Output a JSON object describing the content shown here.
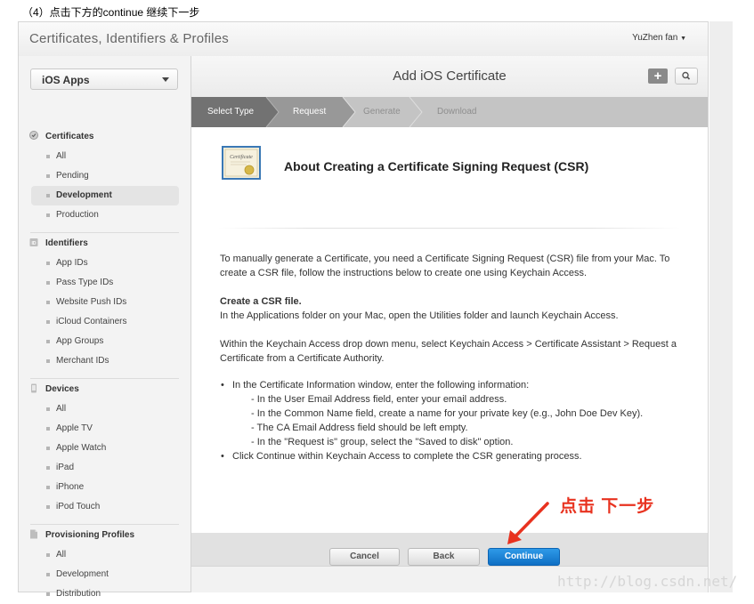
{
  "caption": "（4）点击下方的continue 继续下一步",
  "header": {
    "app_title": "Certificates, Identifiers & Profiles",
    "user": "YuZhen fan"
  },
  "sidebar": {
    "dropdown_value": "iOS Apps",
    "sections": [
      {
        "label": "Certificates",
        "icon": "certificate-icon",
        "items": [
          "All",
          "Pending",
          "Development",
          "Production"
        ]
      },
      {
        "label": "Identifiers",
        "icon": "id-icon",
        "items": [
          "App IDs",
          "Pass Type IDs",
          "Website Push IDs",
          "iCloud Containers",
          "App Groups",
          "Merchant IDs"
        ]
      },
      {
        "label": "Devices",
        "icon": "device-icon",
        "items": [
          "All",
          "Apple TV",
          "Apple Watch",
          "iPad",
          "iPhone",
          "iPod Touch"
        ]
      },
      {
        "label": "Provisioning Profiles",
        "icon": "document-icon",
        "items": [
          "All",
          "Development",
          "Distribution"
        ]
      }
    ],
    "active_item": "Certificates > Development"
  },
  "main": {
    "title": "Add iOS Certificate",
    "steps": [
      "Select Type",
      "Request",
      "Generate",
      "Download"
    ],
    "current_step": "Request",
    "csr_title": "About Creating a Certificate Signing Request (CSR)",
    "cert_icon_text": "Certificate",
    "intro": "To manually generate a Certificate, you need a Certificate Signing Request (CSR) file from your Mac. To create a CSR file, follow the instructions below to create one using Keychain Access.",
    "create_heading": "Create a CSR file.",
    "create_text": "In the Applications folder on your Mac, open the Utilities folder and launch Keychain Access.",
    "within_text": "Within the Keychain Access drop down menu, select Keychain Access > Certificate Assistant > Request a Certificate from a Certificate Authority.",
    "bullet1": "In the Certificate Information window, enter the following information:",
    "subitems": [
      "- In the User Email Address field, enter your email address.",
      "- In the Common Name field, create a name for your private key (e.g., John Doe Dev Key).",
      "- The CA Email Address field should be left empty.",
      "- In the \"Request is\" group, select the \"Saved to disk\" option."
    ],
    "bullet2": "Click Continue within Keychain Access to complete the CSR generating process."
  },
  "buttons": {
    "cancel": "Cancel",
    "back": "Back",
    "continue": "Continue"
  },
  "annotation": "点击 下一步",
  "watermark": "http://blog.csdn.net/",
  "colors": {
    "accent": "#1585d8",
    "annotation": "#e8321f"
  }
}
